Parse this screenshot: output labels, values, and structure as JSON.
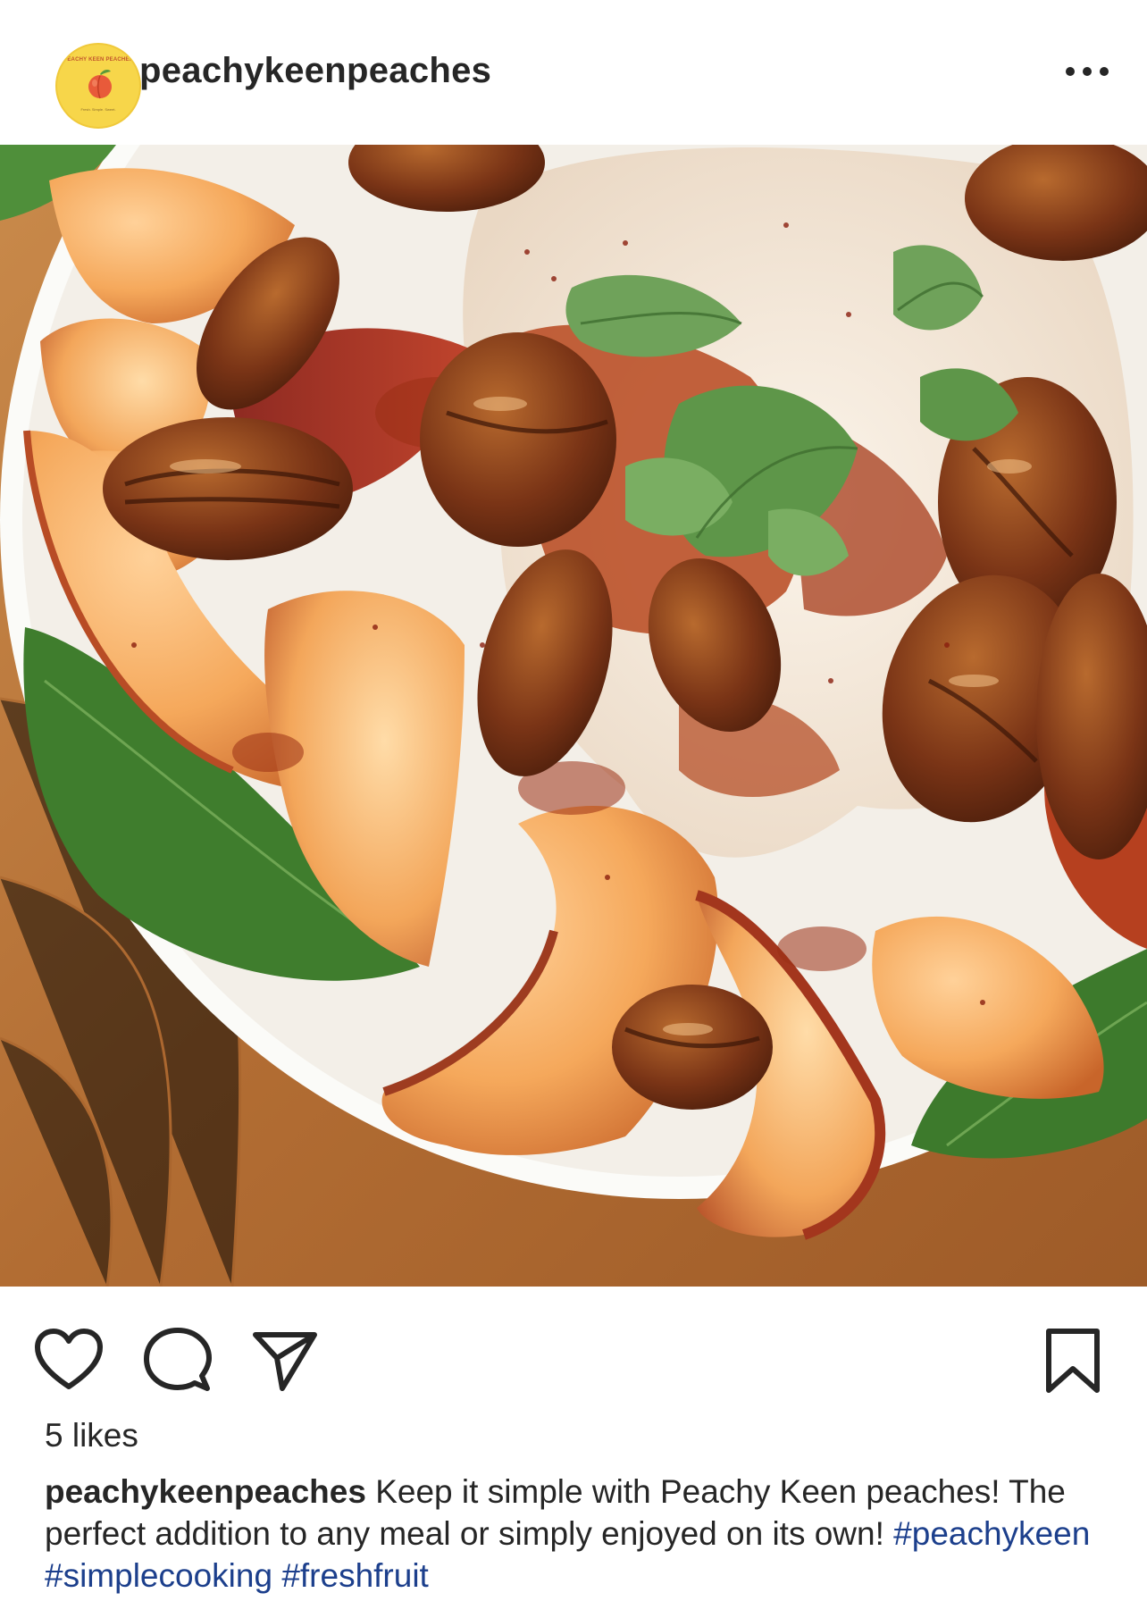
{
  "post": {
    "username": "peachykeenpeaches",
    "avatar": {
      "brand_text": "PEACHY KEEN PEACHES",
      "tagline": "Fresh. Simple. Sweet.",
      "icon": "peach-logo-icon"
    },
    "more_icon": "more-options-icon",
    "photo_description_icon": "food-photo",
    "actions": {
      "like_icon": "heart-icon",
      "comment_icon": "comment-icon",
      "share_icon": "send-icon",
      "save_icon": "bookmark-icon"
    },
    "likes_text": "5 likes",
    "caption": {
      "username": "peachykeenpeaches",
      "text": " Keep it simple with Peachy Keen peaches! The perfect addition to any meal or simply enjoyed on its own! ",
      "hashtags": [
        "#peachykeen",
        "#simplecooking",
        "#freshfruit"
      ]
    }
  },
  "colors": {
    "text": "#262626",
    "hashtag": "#1c3f8c",
    "avatar_bg": "#f7d64a"
  }
}
